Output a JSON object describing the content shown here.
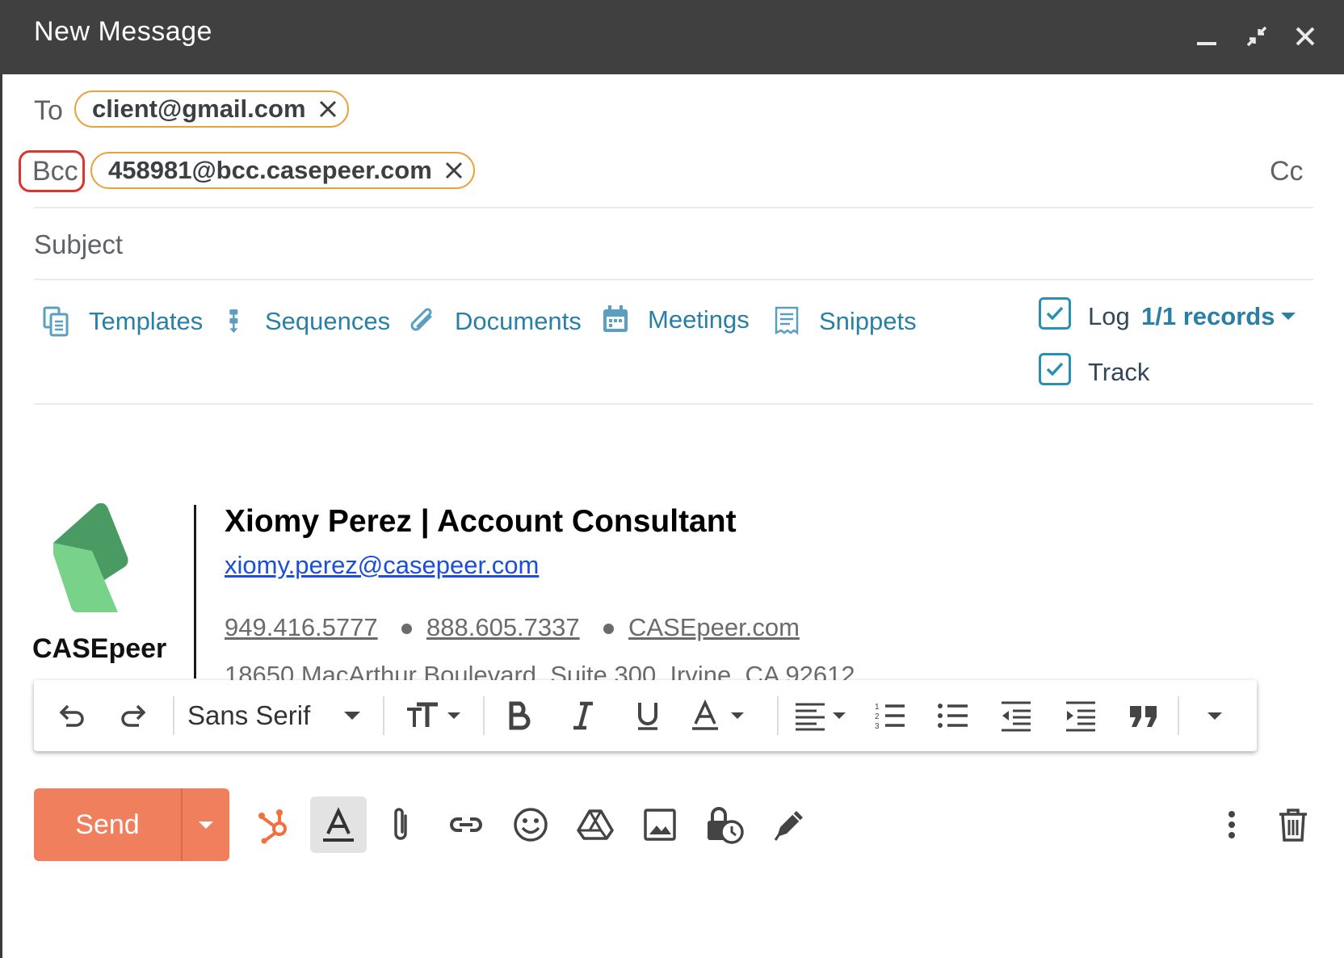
{
  "window": {
    "title": "New Message"
  },
  "recipients": {
    "to_label": "To",
    "to_chip": "client@gmail.com",
    "bcc_label": "Bcc",
    "bcc_chip": "458981@bcc.casepeer.com",
    "cc_label": "Cc"
  },
  "subject": {
    "placeholder": "Subject",
    "value": ""
  },
  "tools": {
    "templates": "Templates",
    "sequences": "Sequences",
    "documents": "Documents",
    "meetings": "Meetings",
    "snippets": "Snippets"
  },
  "logging": {
    "log_label": "Log",
    "log_records": "1/1 records",
    "log_checked": true,
    "track_label": "Track",
    "track_checked": true
  },
  "signature": {
    "logo_text": "CASEpeer",
    "name_line": "Xiomy Perez | Account Consultant",
    "email": "xiomy.perez@casepeer.com",
    "phone1": "949.416.5777",
    "phone2": "888.605.7337",
    "website": "CASEpeer.com",
    "address": "18650 MacArthur Boulevard, Suite 300, Irvine, CA 92612"
  },
  "format_toolbar": {
    "font": "Sans Serif"
  },
  "send": {
    "label": "Send"
  },
  "colors": {
    "header_bg": "#404040",
    "chip_border": "#e8a33d",
    "link_teal": "#2a7fa6",
    "send_orange": "#f07f5e",
    "highlight_red": "#e0342b"
  }
}
